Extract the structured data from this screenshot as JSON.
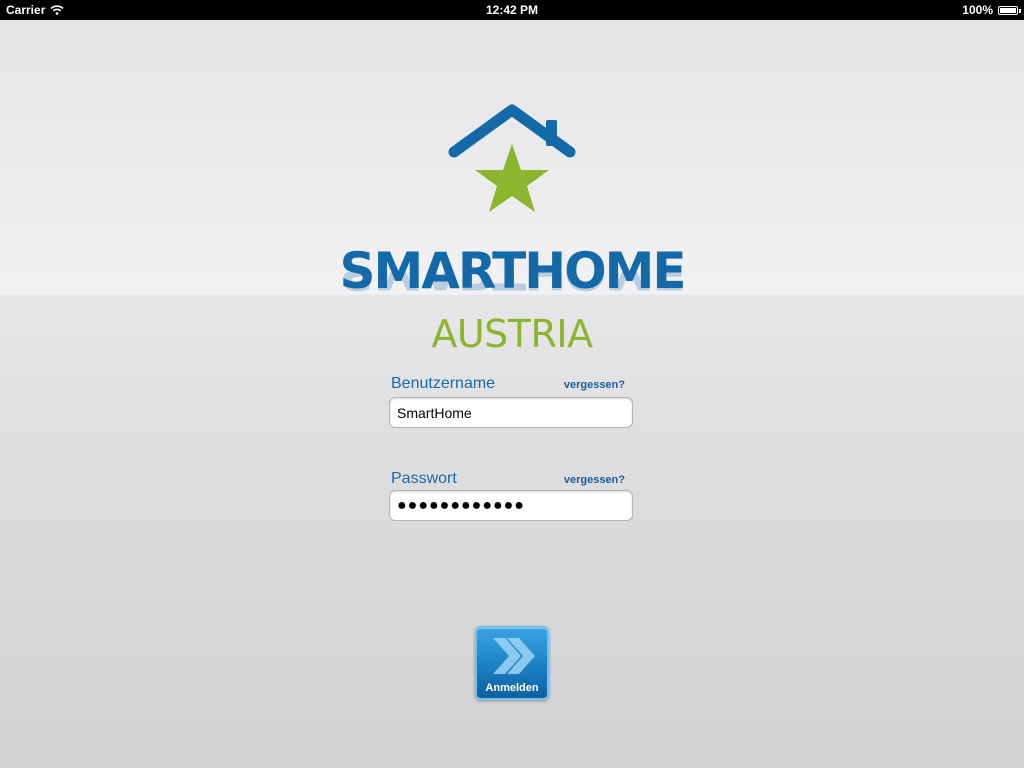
{
  "status_bar": {
    "carrier": "Carrier",
    "time": "12:42 PM",
    "battery": "100%"
  },
  "brand": {
    "title": "SMARTHOME",
    "subtitle": "AUSTRIA"
  },
  "form": {
    "username": {
      "label": "Benutzername",
      "forgot": "vergessen?",
      "value": "SmartHome"
    },
    "password": {
      "label": "Passwort",
      "forgot": "vergessen?",
      "value": "●●●●●●●●●●●●"
    },
    "login_label": "Anmelden"
  },
  "colors": {
    "brand_blue": "#1469a8",
    "brand_green": "#8ab52c",
    "button_blue": "#1e84c8"
  }
}
